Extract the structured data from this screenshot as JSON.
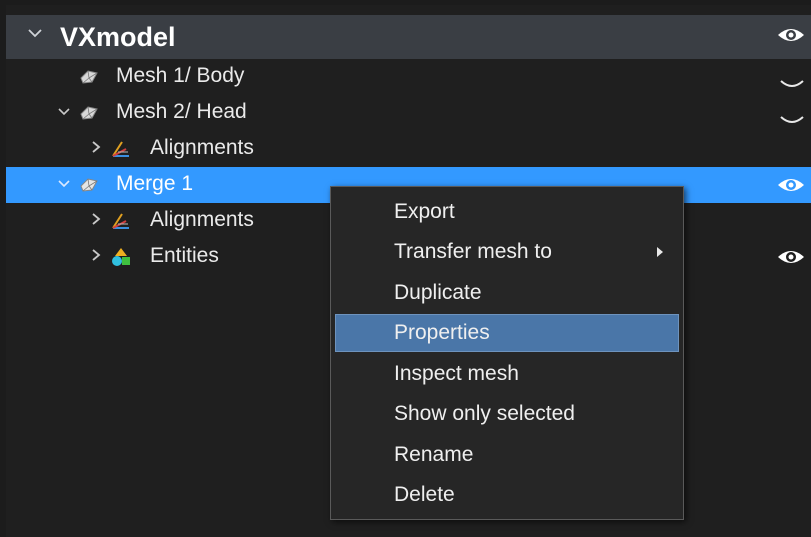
{
  "tree": {
    "root_title": "VXmodel",
    "rows": [
      {
        "label": "Mesh 1/ Body"
      },
      {
        "label": "Mesh 2/ Head"
      },
      {
        "label": "Alignments"
      },
      {
        "label": "Merge 1"
      },
      {
        "label": "Alignments"
      },
      {
        "label": "Entities"
      }
    ]
  },
  "context_menu": {
    "items": [
      {
        "label": "Export"
      },
      {
        "label": "Transfer mesh to"
      },
      {
        "label": "Duplicate"
      },
      {
        "label": "Properties"
      },
      {
        "label": "Inspect mesh"
      },
      {
        "label": "Show only selected"
      },
      {
        "label": "Rename"
      },
      {
        "label": "Delete"
      }
    ],
    "highlighted_item": "Properties"
  },
  "colors": {
    "selection": "#3399ff",
    "menu_highlight": "#4a76a8",
    "header_bg": "#3a3e44",
    "panel_bg": "#1f1f1f"
  },
  "icons": {
    "root_expander": "chevron-down-icon",
    "mesh": "mesh-icon",
    "alignments": "alignments-icon",
    "entities": "entities-icon",
    "visible": "eye-icon",
    "hidden": "closed-eye-icon",
    "submenu": "chevron-right-icon"
  }
}
